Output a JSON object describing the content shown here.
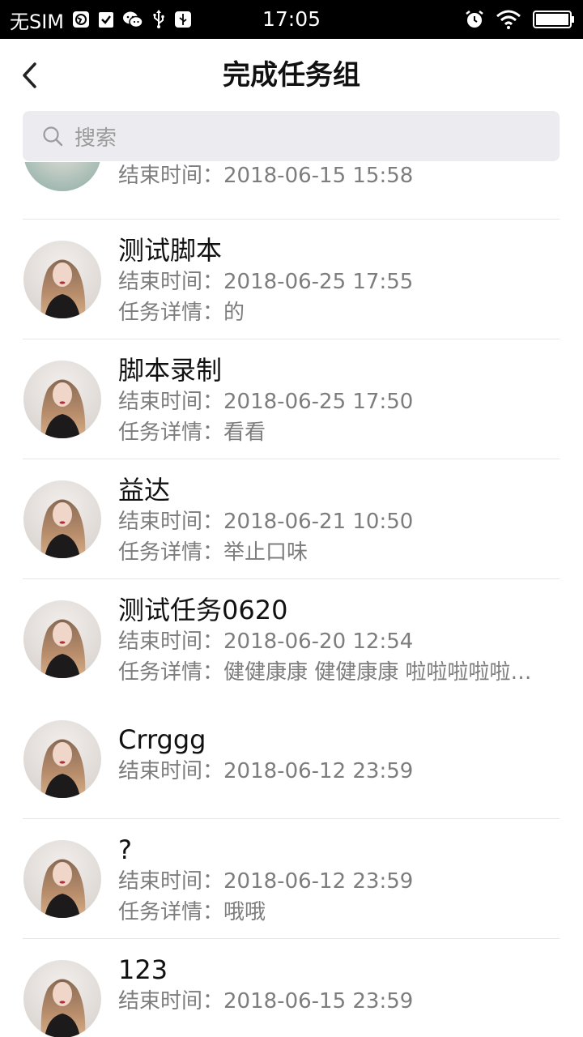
{
  "status_bar": {
    "carrier": "无SIM",
    "time": "17:05"
  },
  "header": {
    "title": "完成任务组"
  },
  "search": {
    "placeholder": "搜索"
  },
  "labels": {
    "end_time": "结束时间：",
    "detail": "任务详情："
  },
  "partial_item": {
    "end_time": "2018-06-15 15:58"
  },
  "tasks": [
    {
      "name": "测试脚本",
      "end_time": "2018-06-25 17:55",
      "detail": "的"
    },
    {
      "name": "脚本录制",
      "end_time": "2018-06-25 17:50",
      "detail": "看看"
    },
    {
      "name": "益达",
      "end_time": "2018-06-21 10:50",
      "detail": "举止口味"
    },
    {
      "name": "测试任务0620",
      "end_time": "2018-06-20 12:54",
      "detail": "健健康康 健健康康 啦啦啦啦啦啦啦"
    },
    {
      "name": "Crrggg",
      "end_time": "2018-06-12 23:59"
    },
    {
      "name": "?",
      "end_time": "2018-06-12 23:59",
      "detail": "哦哦"
    },
    {
      "name": "123",
      "end_time": "2018-06-15 23:59"
    }
  ],
  "colors": {
    "search_bg": "#ececf0",
    "secondary_text": "#7d7d7d",
    "divider": "#e6e6e6"
  }
}
